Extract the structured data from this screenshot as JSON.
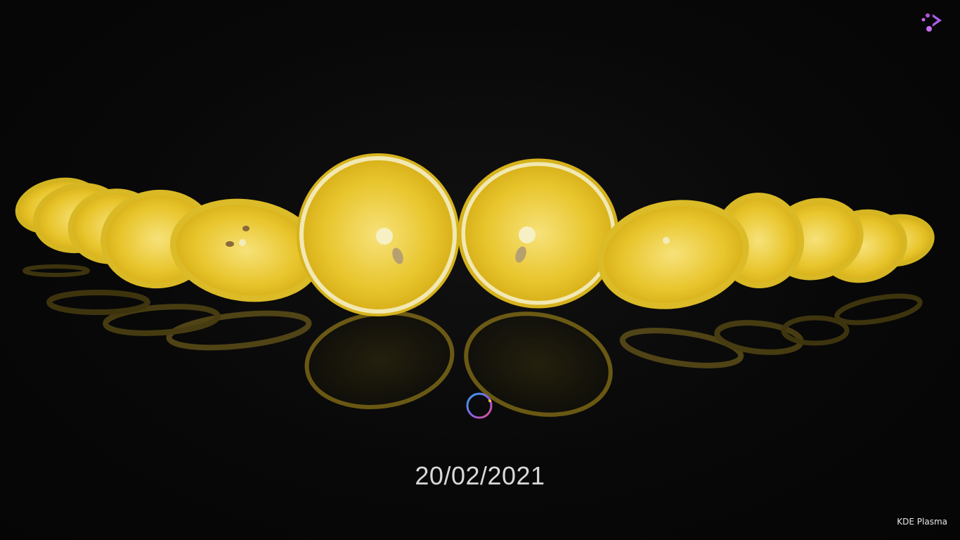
{
  "splash": {
    "date": "20/02/2021",
    "brand_label": "KDE Plasma"
  },
  "icons": {
    "logo": "plasma-logo-icon",
    "spinner": "loading-spinner-icon"
  },
  "colors": {
    "background": "#060606",
    "lemon_rind": "#d9b81e",
    "lemon_flesh": "#f0d23a",
    "lemon_pith": "#f4ecb8",
    "date_text": "#d8d8d8",
    "accent_purple": "#b04fe0",
    "spinner_blue": "#2fa8f0",
    "spinner_pink": "#e8508a"
  }
}
